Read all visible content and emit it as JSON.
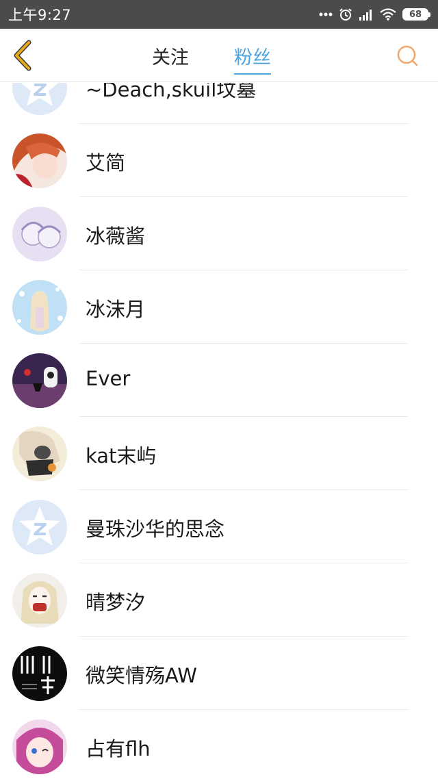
{
  "status_bar": {
    "time": "上午9:27",
    "battery": "68",
    "icons": [
      "dots-icon",
      "alarm-icon",
      "signal-icon",
      "wifi-icon",
      "battery-icon"
    ]
  },
  "header": {
    "back_icon": "chevron-left-icon",
    "tabs": [
      {
        "label": "关注",
        "active": false
      },
      {
        "label": "粉丝",
        "active": true
      }
    ],
    "search_icon": "search-icon"
  },
  "colors": {
    "accent": "#4aa3df",
    "back_icon": "#e8a81e",
    "search_icon": "#f2a56b",
    "status_bar": "#4b4b4b"
  },
  "fans": [
    {
      "name": "~Deach,skuil坟墓",
      "avatar": "default-avatar-icon"
    },
    {
      "name": "艾简",
      "avatar": "user-avatar-image"
    },
    {
      "name": "冰薇酱",
      "avatar": "user-avatar-image"
    },
    {
      "name": "冰沫月",
      "avatar": "user-avatar-image"
    },
    {
      "name": "Ever",
      "avatar": "user-avatar-image"
    },
    {
      "name": "kat末屿",
      "avatar": "user-avatar-image"
    },
    {
      "name": "曼珠沙华的思念",
      "avatar": "default-avatar-icon"
    },
    {
      "name": "晴梦汐",
      "avatar": "user-avatar-image"
    },
    {
      "name": "微笑情殇AW",
      "avatar": "user-avatar-image"
    },
    {
      "name": "占有flh",
      "avatar": "user-avatar-image"
    }
  ]
}
